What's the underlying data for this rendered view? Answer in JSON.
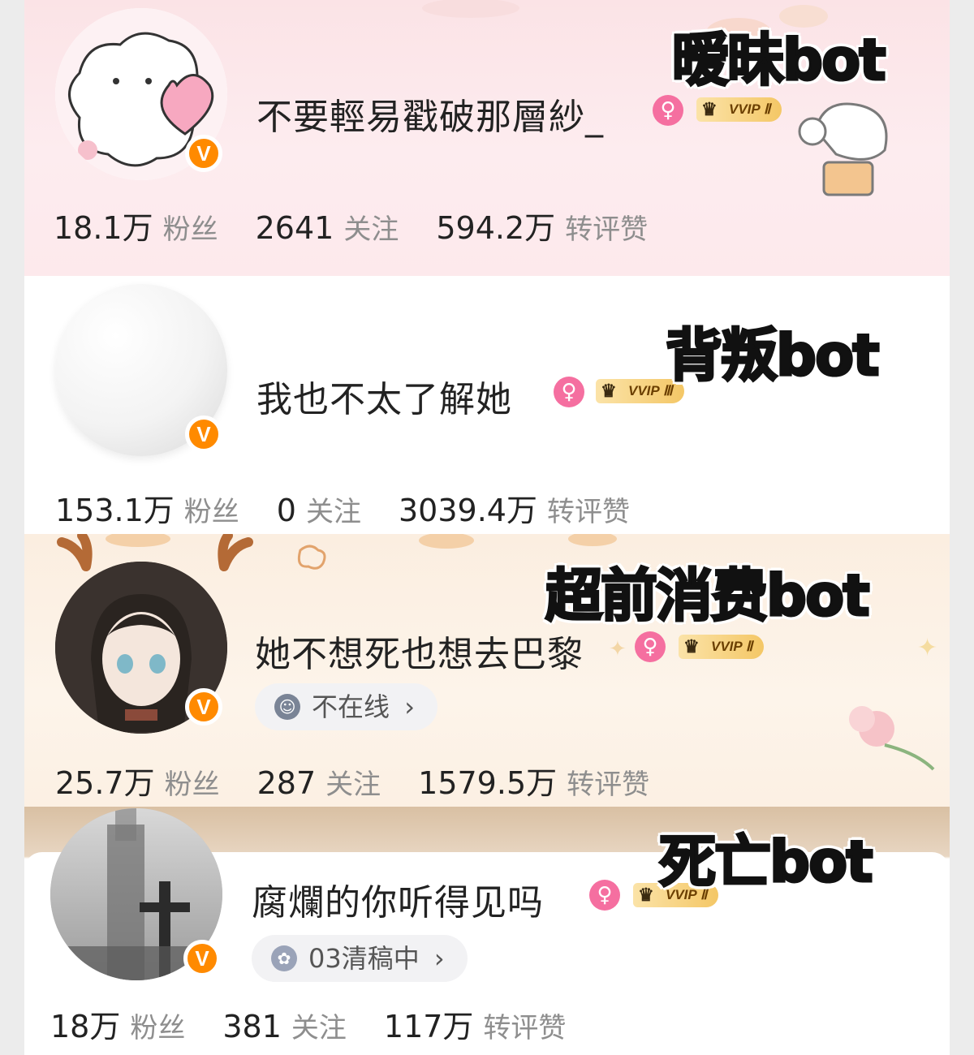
{
  "colors": {
    "vbadge": "#ff8a00",
    "female_badge": "#f56fa0",
    "stat_label": "#8e8e8e",
    "vvip_gold": "#f4c766"
  },
  "icons": {
    "verified": "V",
    "female": "♀",
    "crown": "♛",
    "chevron": "›"
  },
  "profiles": [
    {
      "bot_label": "暧昧bot",
      "name": "不要輕易戳破那層紗_",
      "vip": "VVIP Ⅱ",
      "stats": [
        {
          "value": "18.1万",
          "label": "粉丝"
        },
        {
          "value": "2641",
          "label": "关注"
        },
        {
          "value": "594.2万",
          "label": "转评赞"
        }
      ]
    },
    {
      "bot_label": "背叛bot",
      "name": "我也不太了解她",
      "vip": "VVIP Ⅲ",
      "stats": [
        {
          "value": "153.1万",
          "label": "粉丝"
        },
        {
          "value": "0",
          "label": "关注"
        },
        {
          "value": "3039.4万",
          "label": "转评赞"
        }
      ]
    },
    {
      "bot_label": "超前消费bot",
      "name": "她不想死也想去巴黎",
      "vip": "VVIP Ⅱ",
      "status": "不在线",
      "stats": [
        {
          "value": "25.7万",
          "label": "粉丝"
        },
        {
          "value": "287",
          "label": "关注"
        },
        {
          "value": "1579.5万",
          "label": "转评赞"
        }
      ]
    },
    {
      "bot_label": "死亡bot",
      "name": "腐爛的你听得见吗",
      "vip": "VVIP Ⅱ",
      "status": "03清稿中",
      "stats": [
        {
          "value": "18万",
          "label": "粉丝"
        },
        {
          "value": "381",
          "label": "关注"
        },
        {
          "value": "117万",
          "label": "转评赞"
        }
      ]
    }
  ]
}
